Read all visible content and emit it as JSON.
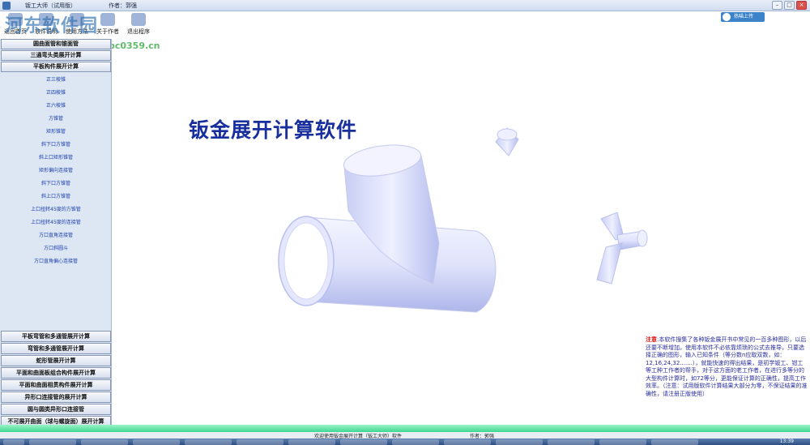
{
  "titlebar": {
    "title": "钣工大师（试用版）",
    "author": "作者：郭强"
  },
  "toolbar": {
    "items": [
      {
        "label": "返回首页",
        "icon": "home-icon"
      },
      {
        "label": "软件说明",
        "icon": "help-icon"
      },
      {
        "label": "使用方法",
        "icon": "book-icon"
      },
      {
        "label": "关于作者",
        "icon": "person-icon"
      },
      {
        "label": "退出程序",
        "icon": "exit-icon"
      }
    ]
  },
  "watermark": {
    "text": "河东软件园",
    "url": "www.pc0359.cn"
  },
  "cloud_button": {
    "label": "热喵上传",
    "icon": "cloud-icon"
  },
  "sidebar": {
    "top_categories": [
      "圆曲面管和锥面管",
      "三通弯头类展开计算",
      "平板构件展开计算"
    ],
    "sub_items": [
      "正三棱锥",
      "正四棱锥",
      "正六棱锥",
      "方锥管",
      "矩形锥管",
      "斜下口方锥管",
      "斜上口矩形锥管",
      "矩形偏向连接管",
      "斜下口方锥管",
      "斜上口方锥管",
      "上口扭转45度的方锥管",
      "上口扭转45度的连接管",
      "方口直角连接管",
      "方口斜圆斗",
      "方口直角偏心连接管"
    ],
    "bottom_categories": [
      "平板弯管和多通管展开计算",
      "弯管和多通管展开计算",
      "蛇形管展开计算",
      "平面和曲面板组合构件展开计算",
      "平面和曲面相贯构件展开计算",
      "异形口连接管的展开计算",
      "圆与圆类异形口连接管",
      "不可展开曲面（球与螺旋面）展开计算"
    ]
  },
  "main": {
    "title": "钣金展开计算软件"
  },
  "note": {
    "label": "注意",
    "text": "本软件搜集了各种钣金展开书中常见的一百多种图形，以后还要不断增加。使用本软件不必依靠烦琐的公式去推导，只要选择正确的图形，输入已知条件（等分数n应取双数，如：12,16,24,32.......），就能快速的得出结果，是初学钣工、钳工等工种工作者的帮手，对于这方面的老工作者，在进行多等分的大型构件计算时，如72等分，更能保证计算的正确性，提高工作效率。（注意：试用版软件计算结果大部分为零，不保证结果的准确性，请注册正版使用）"
  },
  "statusbar": {
    "left": "欢迎使用钣金展开计算（钣工大师）软件",
    "right": "作者：郭强"
  },
  "taskbar": {
    "clock": "13:39"
  },
  "colors": {
    "sidebar_bg": "#dde6f3",
    "title_color": "#1a2f9e",
    "link_color": "#1b3fb0",
    "green_bar": "#3ed692",
    "pipe_fill": "#dfe3fb"
  }
}
